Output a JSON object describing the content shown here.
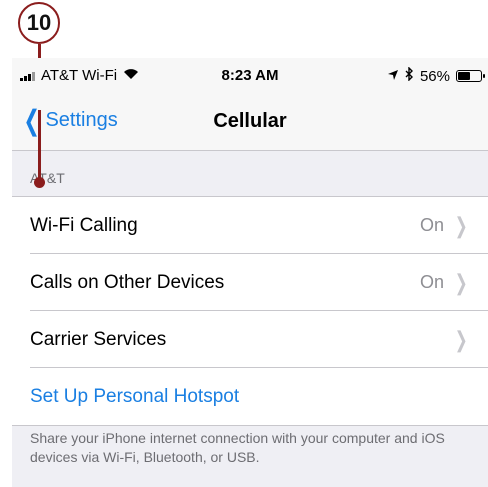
{
  "callout": {
    "number": "10"
  },
  "statusbar": {
    "carrier": "AT&T Wi-Fi",
    "time": "8:23 AM",
    "battery_percent": "56%",
    "battery_level": 0.56,
    "icons": [
      "signal-icon",
      "wifi-icon",
      "location-icon",
      "bluetooth-icon",
      "battery-icon"
    ]
  },
  "navbar": {
    "back_label": "Settings",
    "title": "Cellular"
  },
  "section": {
    "header": "AT&T"
  },
  "rows": [
    {
      "label": "Wi-Fi Calling",
      "value": "On"
    },
    {
      "label": "Calls on Other Devices",
      "value": "On"
    },
    {
      "label": "Carrier Services",
      "value": ""
    },
    {
      "label": "Set Up Personal Hotspot"
    }
  ],
  "footer": {
    "text": "Share your iPhone internet connection with your computer and iOS devices via Wi-Fi, Bluetooth, or USB."
  },
  "colors": {
    "accent": "#1a7fe2",
    "callout": "#8b1d1d",
    "background": "#efeff4"
  }
}
